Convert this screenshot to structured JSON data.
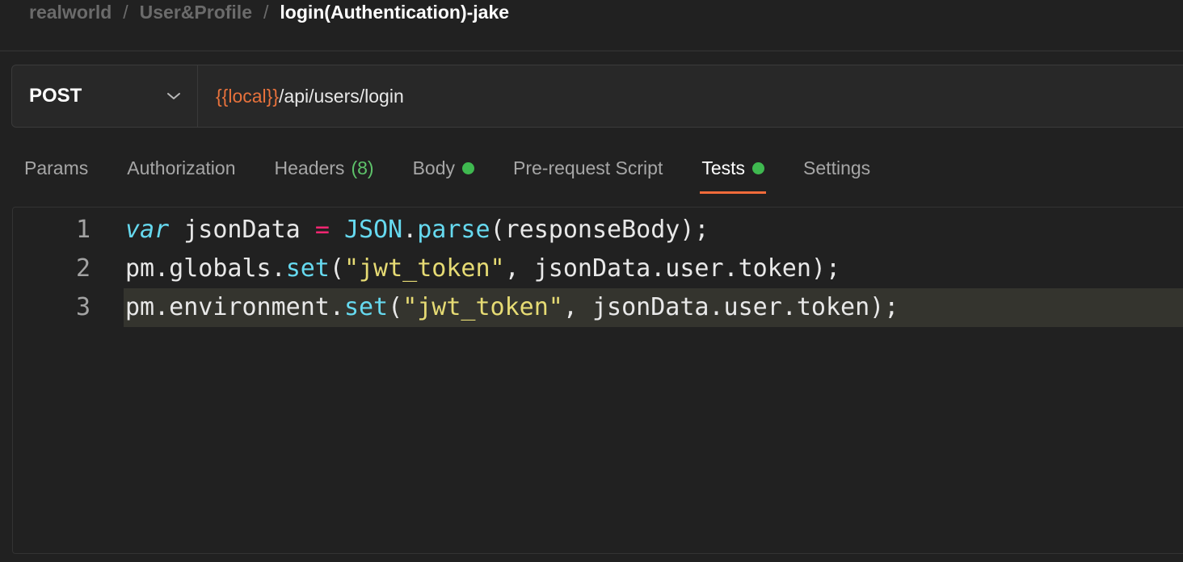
{
  "breadcrumb": {
    "items": [
      "realworld",
      "User&Profile",
      "login(Authentication)-jake"
    ],
    "separator": "/"
  },
  "request": {
    "method": "POST",
    "url_variable": "{{local}}",
    "url_path": "/api/users/login"
  },
  "tabs": [
    {
      "label": "Params"
    },
    {
      "label": "Authorization"
    },
    {
      "label": "Headers",
      "count": "(8)"
    },
    {
      "label": "Body",
      "indicator": true
    },
    {
      "label": "Pre-request Script"
    },
    {
      "label": "Tests",
      "indicator": true,
      "active": true
    },
    {
      "label": "Settings"
    }
  ],
  "editor": {
    "lines": [
      {
        "number": "1",
        "tokens": [
          {
            "t": "kw",
            "v": "var"
          },
          {
            "t": "plain",
            "v": " jsonData "
          },
          {
            "t": "op",
            "v": "="
          },
          {
            "t": "plain",
            "v": " "
          },
          {
            "t": "cls",
            "v": "JSON"
          },
          {
            "t": "plain",
            "v": "."
          },
          {
            "t": "fn",
            "v": "parse"
          },
          {
            "t": "plain",
            "v": "(responseBody);"
          }
        ]
      },
      {
        "number": "2",
        "tokens": [
          {
            "t": "plain",
            "v": "pm.globals."
          },
          {
            "t": "fn",
            "v": "set"
          },
          {
            "t": "plain",
            "v": "("
          },
          {
            "t": "str",
            "v": "\"jwt_token\""
          },
          {
            "t": "plain",
            "v": ", jsonData.user.token);"
          }
        ]
      },
      {
        "number": "3",
        "highlighted": true,
        "tokens": [
          {
            "t": "plain",
            "v": "pm.environment."
          },
          {
            "t": "fn",
            "v": "set"
          },
          {
            "t": "plain",
            "v": "("
          },
          {
            "t": "str",
            "v": "\"jwt_token\""
          },
          {
            "t": "plain",
            "v": ", jsonData.user.token);"
          }
        ]
      }
    ]
  },
  "colors": {
    "accent": "#f26b3a",
    "indicator": "#3fb950",
    "variable": "#e8723c"
  }
}
